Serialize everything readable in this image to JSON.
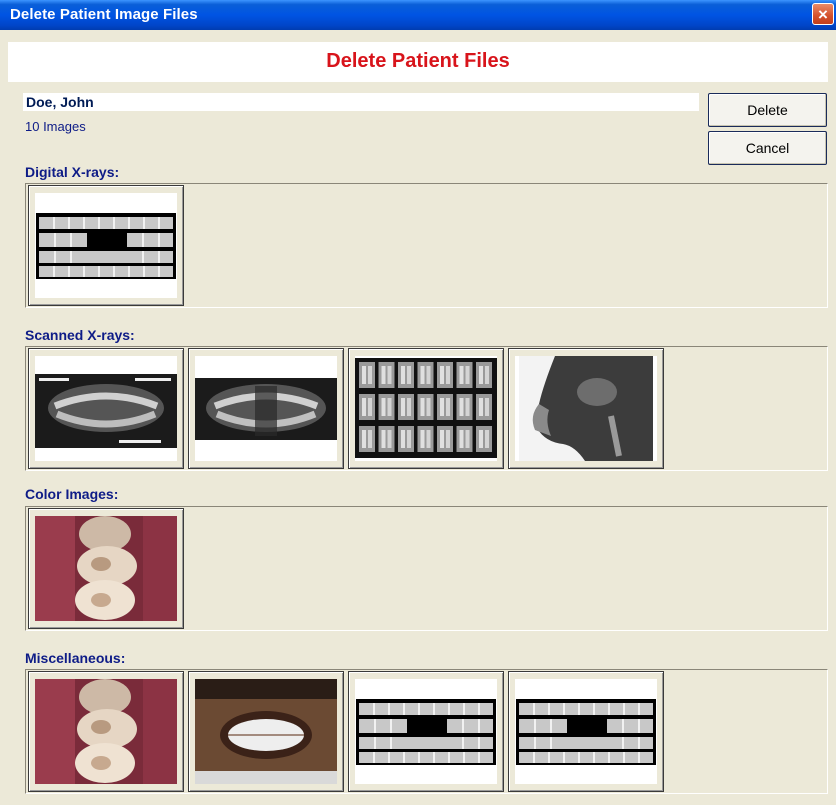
{
  "window": {
    "title": "Delete Patient Image Files",
    "close_icon": "×"
  },
  "dialog": {
    "heading": "Delete Patient Files"
  },
  "patient": {
    "name": "Doe, John",
    "image_count": "10 Images"
  },
  "buttons": {
    "delete": "Delete",
    "cancel": "Cancel"
  },
  "sections": [
    {
      "label": "Digital X-rays:",
      "thumbnails": [
        "fmx-template-icon"
      ]
    },
    {
      "label": "Scanned X-rays:",
      "thumbnails": [
        "panoramic-xray-labeled",
        "panoramic-xray",
        "full-mouth-series",
        "cephalometric-xray"
      ]
    },
    {
      "label": "Color Images:",
      "thumbnails": [
        "intraoral-molars-photo"
      ]
    },
    {
      "label": "Miscellaneous:",
      "thumbnails": [
        "intraoral-molars-photo",
        "smile-photo",
        "fmx-template-icon",
        "fmx-template-icon"
      ]
    }
  ],
  "colors": {
    "title_bar": "#0054e3",
    "heading": "#d8141b",
    "section_label": "#0e1c87",
    "dialog_bg": "#ece9d8"
  }
}
